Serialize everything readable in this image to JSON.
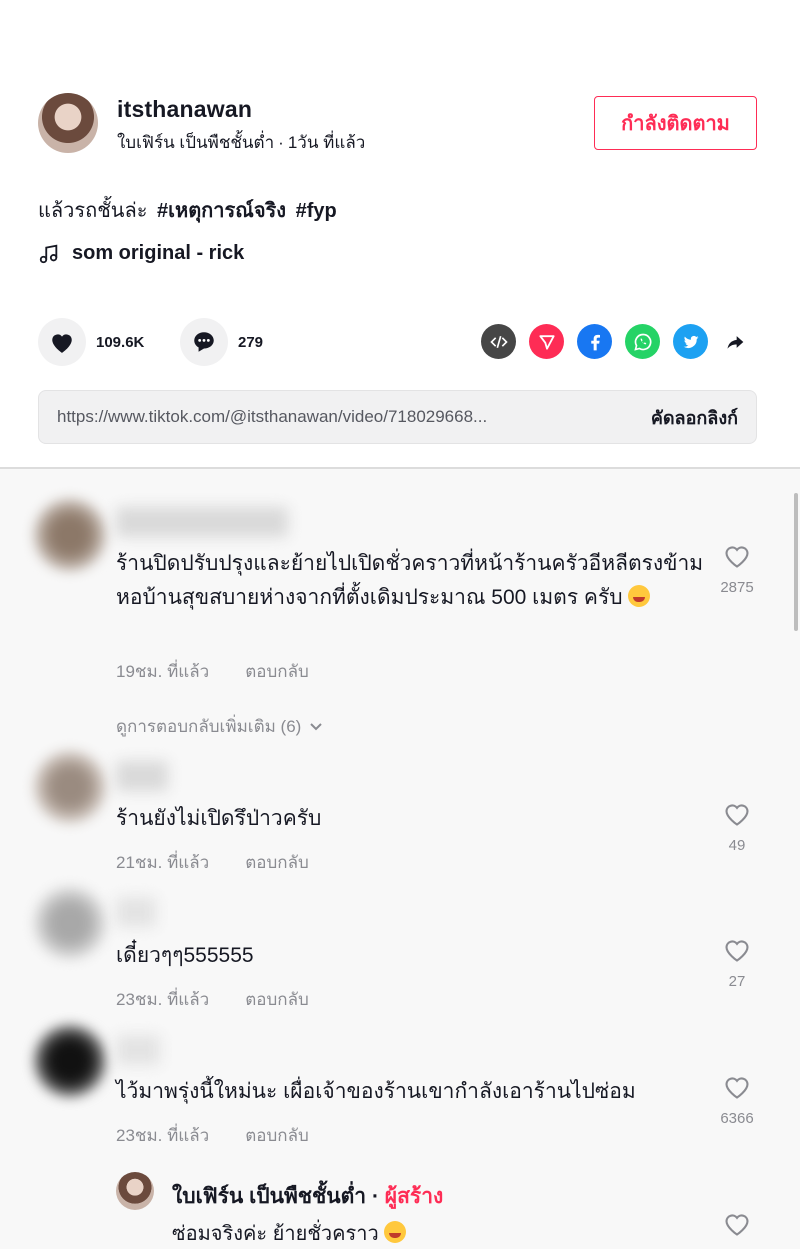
{
  "author": {
    "username": "itsthanawan",
    "nickname": "ใบเฟิร์น เป็นพืชชั้นต่ำ",
    "separator": "·",
    "time": "1วัน ที่แล้ว",
    "follow_label": "กำลังติดตาม"
  },
  "caption": {
    "text": "แล้วรถชั้นล่ะ",
    "hashtags": [
      "#เหตุการณ์จริง",
      "#fyp"
    ]
  },
  "music": {
    "icon": "music-note-icon",
    "title": "som original - rick"
  },
  "actions": {
    "likes": "109.6K",
    "comments": "279"
  },
  "share_icons": [
    "embed-icon",
    "send-to-friends-icon",
    "facebook-icon",
    "whatsapp-icon",
    "twitter-icon",
    "share-arrow-icon"
  ],
  "link": {
    "url": "https://www.tiktok.com/@itsthanawan/video/718029668...",
    "copy_label": "คัดลอกลิงก์"
  },
  "comments": [
    {
      "text": "ร้านปิดปรับปรุงและย้ายไปเปิดชั่วคราวที่หน้าร้านครัวอีหลีตรงข้ามหอบ้านสุขสบายห่างจากที่ตั้งเดิมประมาณ 500 เมตร ครับ",
      "time": "19ชม. ที่แล้ว",
      "reply_label": "ตอบกลับ",
      "likes": "2875",
      "more_replies": "ดูการตอบกลับเพิ่มเติม (6)"
    },
    {
      "text": "ร้านยังไม่เปิดรึป่าวครับ",
      "time": "21ชม. ที่แล้ว",
      "reply_label": "ตอบกลับ",
      "likes": "49"
    },
    {
      "text": "เดี๋ยวๆๆ555555",
      "time": "23ชม. ที่แล้ว",
      "reply_label": "ตอบกลับ",
      "likes": "27"
    },
    {
      "text": "ไว้มาพรุ่งนี้ใหม่นะ เผื่อเจ้าของร้านเขากำลังเอาร้านไปซ่อม",
      "time": "23ชม. ที่แล้ว",
      "reply_label": "ตอบกลับ",
      "likes": "6366"
    }
  ],
  "reply": {
    "name": "ใบเฟิร์น เป็นพืชชั้นต่ำ",
    "separator": "·",
    "creator_label": "ผู้สร้าง",
    "text": "ซ่อมจริงค่ะ ย้ายชั่วคราว"
  },
  "colors": {
    "accent": "#fe2c55",
    "muted": "#8a8b91",
    "text": "#161823"
  }
}
